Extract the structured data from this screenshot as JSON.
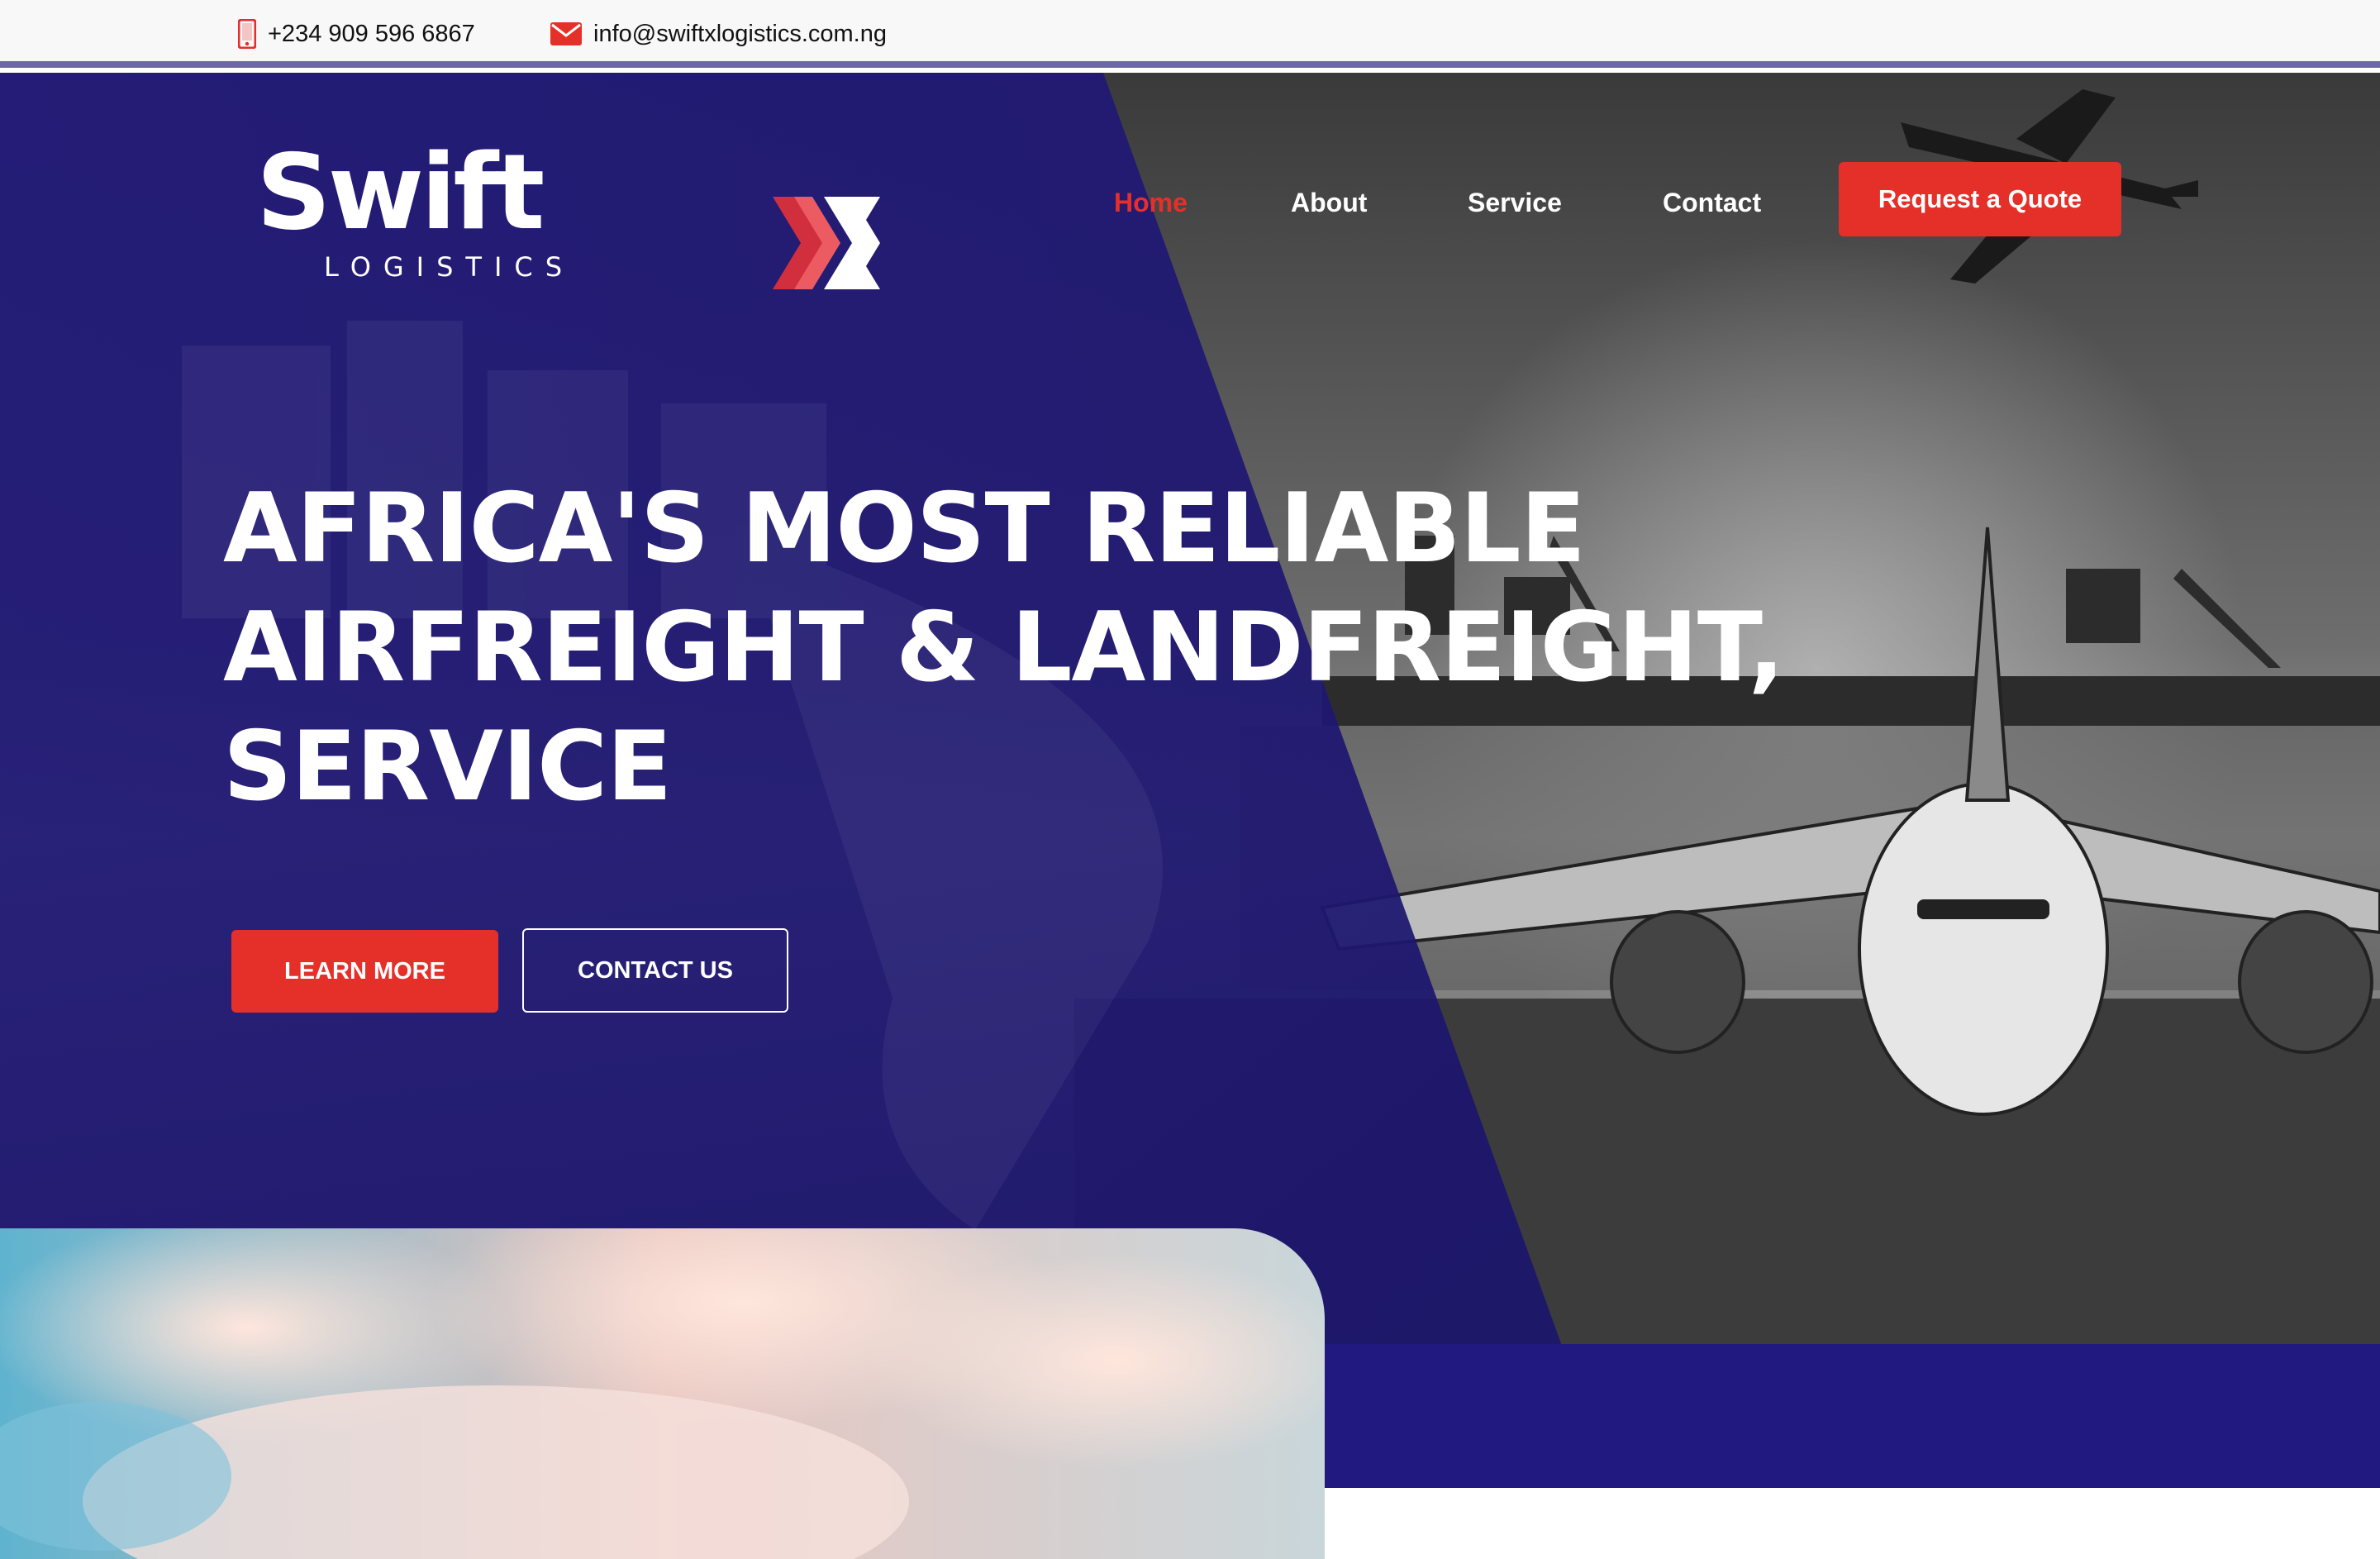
{
  "topbar": {
    "phone": "+234 909 596 6867",
    "email": "info@swiftxlogistics.com.ng",
    "phone_icon": "mobile-phone-icon",
    "email_icon": "envelope-icon"
  },
  "brand": {
    "name": "Swift",
    "name_accent": "X",
    "tagline": "LOGISTICS"
  },
  "nav": {
    "items": [
      {
        "label": "Home",
        "active": true
      },
      {
        "label": "About",
        "active": false
      },
      {
        "label": "Service",
        "active": false
      },
      {
        "label": "Contact",
        "active": false
      }
    ],
    "cta": "Request a Quote"
  },
  "hero": {
    "title_lines": [
      "AFRICA'S MOST RELIABLE",
      "AIRFREIGHT & LANDFREIGHT,",
      "SERVICE"
    ],
    "primary_button": "LEARN MORE",
    "secondary_button": "CONTACT US"
  },
  "colors": {
    "accent_red": "#e5302a",
    "navy": "#1e1677",
    "topbar_bg": "#f8f8f8"
  }
}
